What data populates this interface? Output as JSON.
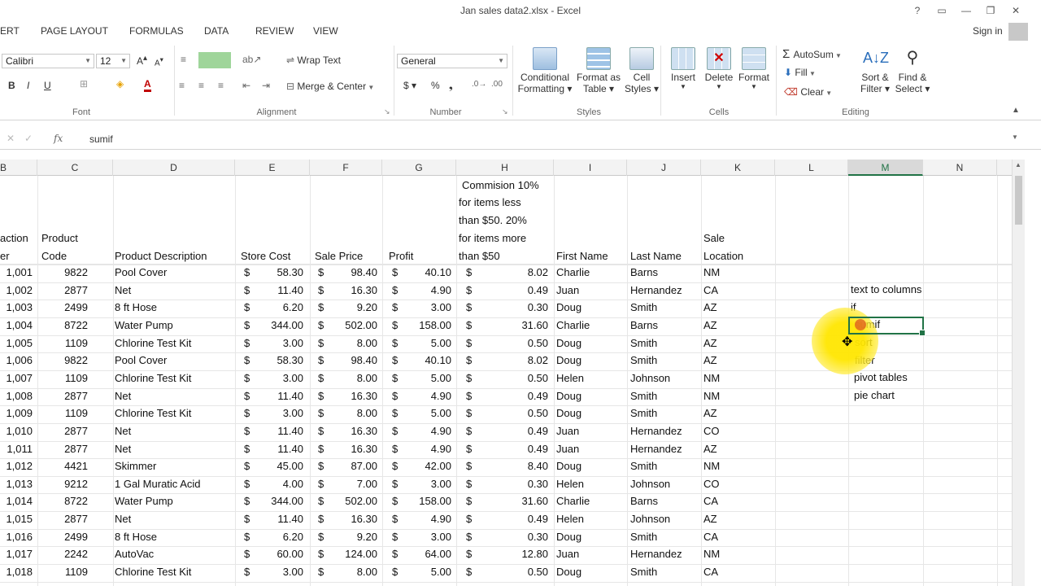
{
  "window": {
    "title": "Jan sales data2.xlsx - Excel"
  },
  "tabs": [
    "ERT",
    "PAGE LAYOUT",
    "FORMULAS",
    "DATA",
    "REVIEW",
    "VIEW"
  ],
  "account": {
    "sign_in": "Sign in"
  },
  "ribbon": {
    "font_name": "Calibri",
    "font_size": "12",
    "wrap_text": "Wrap Text",
    "merge_center": "Merge & Center",
    "number_format": "General",
    "conditional_formatting": [
      "Conditional",
      "Formatting ▾"
    ],
    "format_as_table": [
      "Format as",
      "Table ▾"
    ],
    "cell_styles": [
      "Cell",
      "Styles ▾"
    ],
    "insert": "Insert",
    "delete": "Delete",
    "format": "Format",
    "autosum": "AutoSum",
    "fill": "Fill",
    "clear": "Clear",
    "sort_filter": [
      "Sort &",
      "Filter ▾"
    ],
    "find_select": [
      "Find &",
      "Select ▾"
    ],
    "groups": {
      "font": "Font",
      "alignment": "Alignment",
      "number": "Number",
      "styles": "Styles",
      "cells": "Cells",
      "editing": "Editing"
    }
  },
  "formula_bar": {
    "fx": "fx",
    "content": "sumif"
  },
  "columns": [
    "B",
    "C",
    "D",
    "E",
    "F",
    "G",
    "H",
    "I",
    "J",
    "K",
    "L",
    "M",
    "N"
  ],
  "selected_column": "M",
  "headers": {
    "b": "action",
    "b2": "er",
    "c1": "Product",
    "c2": "Code",
    "d": "Product Description",
    "e": "Store Cost",
    "f": "Sale Price",
    "g": "Profit",
    "h": [
      "Commision 10%",
      "for items less",
      "than $50. 20%",
      "for items more",
      "than $50"
    ],
    "i": "First Name",
    "j": "Last Name",
    "k1": "Sale",
    "k2": "Location"
  },
  "rows": [
    [
      "1,001",
      "9822",
      "Pool Cover",
      "58.30",
      "98.40",
      "40.10",
      "8.02",
      "Charlie",
      "Barns",
      "NM"
    ],
    [
      "1,002",
      "2877",
      "Net",
      "11.40",
      "16.30",
      "4.90",
      "0.49",
      "Juan",
      "Hernandez",
      "CA"
    ],
    [
      "1,003",
      "2499",
      "8 ft Hose",
      "6.20",
      "9.20",
      "3.00",
      "0.30",
      "Doug",
      "Smith",
      "AZ"
    ],
    [
      "1,004",
      "8722",
      "Water Pump",
      "344.00",
      "502.00",
      "158.00",
      "31.60",
      "Charlie",
      "Barns",
      "AZ"
    ],
    [
      "1,005",
      "1109",
      "Chlorine Test Kit",
      "3.00",
      "8.00",
      "5.00",
      "0.50",
      "Doug",
      "Smith",
      "AZ"
    ],
    [
      "1,006",
      "9822",
      "Pool Cover",
      "58.30",
      "98.40",
      "40.10",
      "8.02",
      "Doug",
      "Smith",
      "AZ"
    ],
    [
      "1,007",
      "1109",
      "Chlorine Test Kit",
      "3.00",
      "8.00",
      "5.00",
      "0.50",
      "Helen",
      "Johnson",
      "NM"
    ],
    [
      "1,008",
      "2877",
      "Net",
      "11.40",
      "16.30",
      "4.90",
      "0.49",
      "Doug",
      "Smith",
      "NM"
    ],
    [
      "1,009",
      "1109",
      "Chlorine Test Kit",
      "3.00",
      "8.00",
      "5.00",
      "0.50",
      "Doug",
      "Smith",
      "AZ"
    ],
    [
      "1,010",
      "2877",
      "Net",
      "11.40",
      "16.30",
      "4.90",
      "0.49",
      "Juan",
      "Hernandez",
      "CO"
    ],
    [
      "1,011",
      "2877",
      "Net",
      "11.40",
      "16.30",
      "4.90",
      "0.49",
      "Juan",
      "Hernandez",
      "AZ"
    ],
    [
      "1,012",
      "4421",
      "Skimmer",
      "45.00",
      "87.00",
      "42.00",
      "8.40",
      "Doug",
      "Smith",
      "NM"
    ],
    [
      "1,013",
      "9212",
      "1 Gal Muratic Acid",
      "4.00",
      "7.00",
      "3.00",
      "0.30",
      "Helen",
      "Johnson",
      "CO"
    ],
    [
      "1,014",
      "8722",
      "Water Pump",
      "344.00",
      "502.00",
      "158.00",
      "31.60",
      "Charlie",
      "Barns",
      "CA"
    ],
    [
      "1,015",
      "2877",
      "Net",
      "11.40",
      "16.30",
      "4.90",
      "0.49",
      "Helen",
      "Johnson",
      "AZ"
    ],
    [
      "1,016",
      "2499",
      "8 ft Hose",
      "6.20",
      "9.20",
      "3.00",
      "0.30",
      "Doug",
      "Smith",
      "CA"
    ],
    [
      "1,017",
      "2242",
      "AutoVac",
      "60.00",
      "124.00",
      "64.00",
      "12.80",
      "Juan",
      "Hernandez",
      "NM"
    ],
    [
      "1,018",
      "1109",
      "Chlorine Test Kit",
      "3.00",
      "8.00",
      "5.00",
      "0.50",
      "Doug",
      "Smith",
      "CA"
    ]
  ],
  "currency_symbol": "$",
  "topics": [
    "text to columns",
    "if",
    "sumif",
    "sort",
    "filter",
    "pivot tables",
    "pie chart"
  ]
}
